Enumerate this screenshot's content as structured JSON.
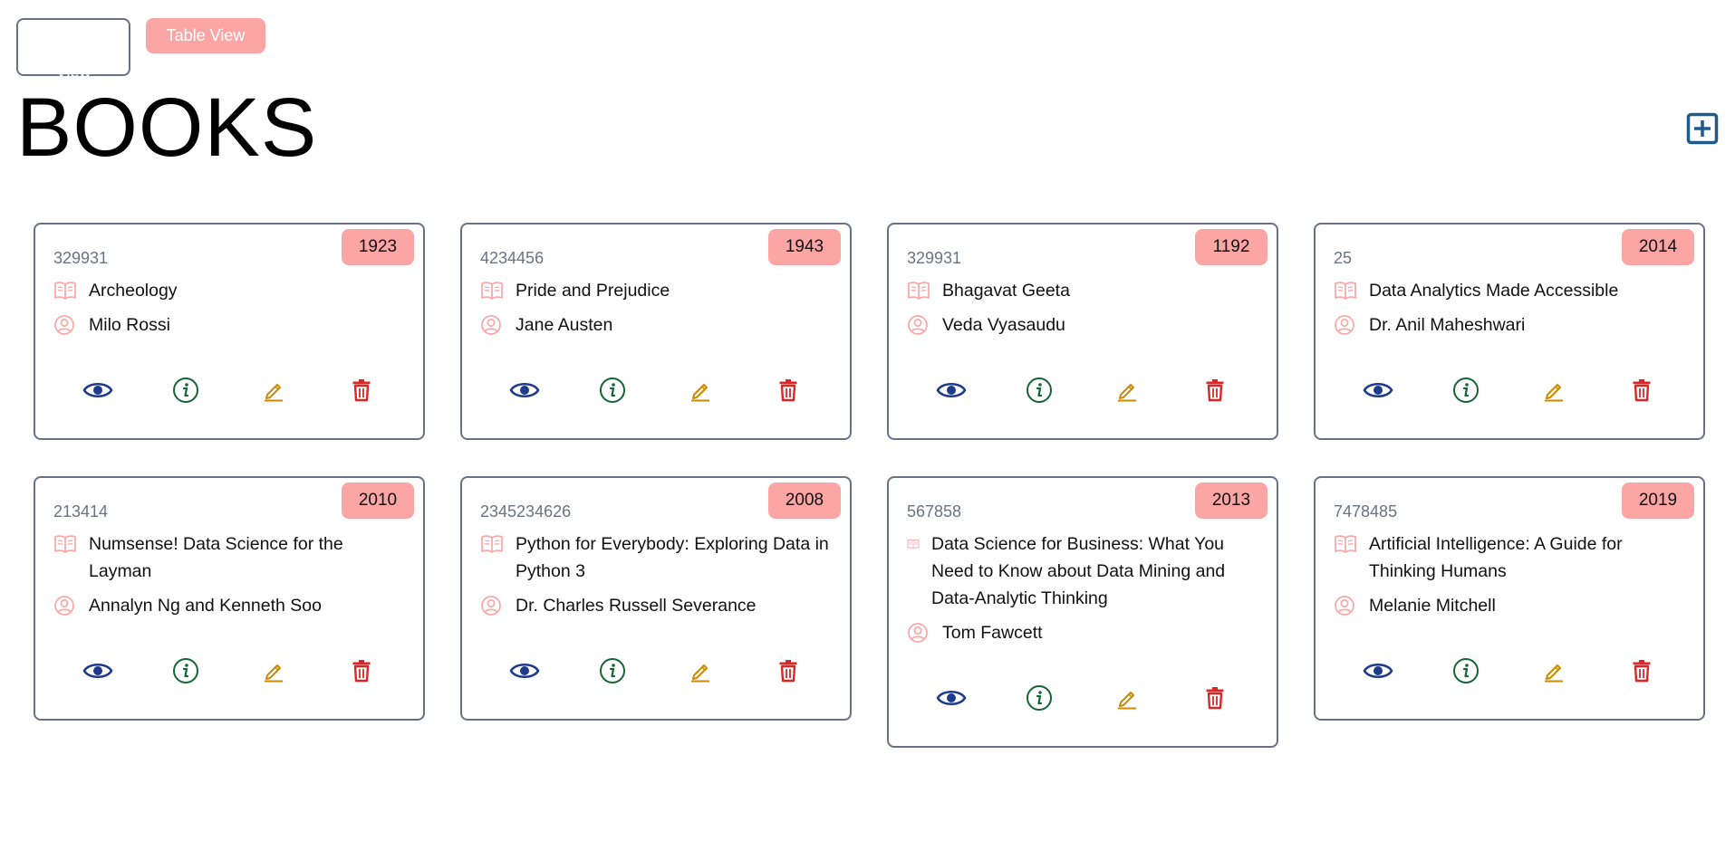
{
  "toolbar": {
    "card_view_label": "Card View",
    "table_view_label": "Table View"
  },
  "header": {
    "title": "BOOKS",
    "add_icon": "plus-square-icon"
  },
  "colors": {
    "accent": "#fca5a5",
    "view": "#1e3a8a",
    "info": "#166534",
    "edit": "#ca8a04",
    "delete": "#dc2626",
    "add": "#1e5a8a",
    "card_border": "#6b7087"
  },
  "icons": {
    "title": "book-open-icon",
    "author": "user-circle-icon",
    "view": "eye-icon",
    "info": "info-circle-icon",
    "edit": "pencil-icon",
    "delete": "trash-icon"
  },
  "books": [
    {
      "isbn": "329931",
      "year": "1923",
      "title": "Archeology",
      "author": "Milo Rossi"
    },
    {
      "isbn": "4234456",
      "year": "1943",
      "title": "Pride and Prejudice",
      "author": "Jane Austen"
    },
    {
      "isbn": "329931",
      "year": "1192",
      "title": "Bhagavat Geeta",
      "author": "Veda Vyasaudu"
    },
    {
      "isbn": "25",
      "year": "2014",
      "title": "Data Analytics Made Accessible",
      "author": "Dr. Anil Maheshwari"
    },
    {
      "isbn": "213414",
      "year": "2010",
      "title": "Numsense! Data Science for the Layman",
      "author": "Annalyn Ng and Kenneth Soo"
    },
    {
      "isbn": "2345234626",
      "year": "2008",
      "title": "Python for Everybody: Exploring Data in Python 3",
      "author": "Dr. Charles Russell Severance"
    },
    {
      "isbn": "567858",
      "year": "2013",
      "title": "Data Science for Business: What You Need to Know about Data Mining and Data-Analytic Thinking",
      "author": "Tom Fawcett"
    },
    {
      "isbn": "7478485",
      "year": "2019",
      "title": "Artificial Intelligence: A Guide for Thinking Humans",
      "author": "Melanie Mitchell"
    }
  ]
}
